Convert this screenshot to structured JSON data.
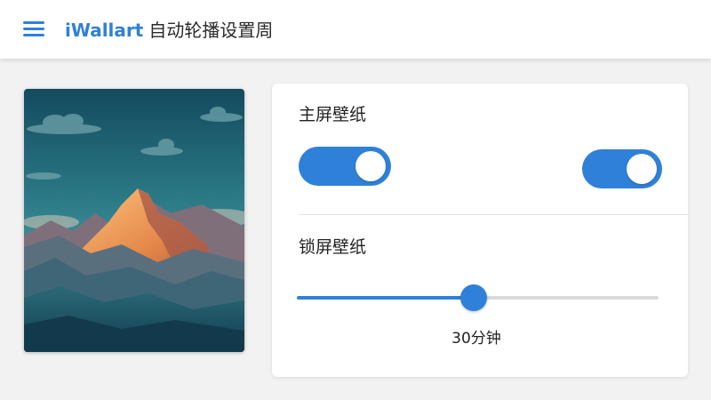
{
  "header": {
    "brand": "iWallart",
    "title": "自动轮播设置周"
  },
  "colors": {
    "accent": "#2f80d8",
    "track": "#d9d9d9"
  },
  "home_wallpaper": {
    "label": "主屏壁纸",
    "toggle_left_on": true,
    "toggle_right_on": true
  },
  "lock_wallpaper": {
    "label": "锁屏壁纸",
    "slider_fraction": 0.49,
    "value_label": "30分钟"
  },
  "icons": {
    "menu": "hamburger-menu-icon"
  }
}
